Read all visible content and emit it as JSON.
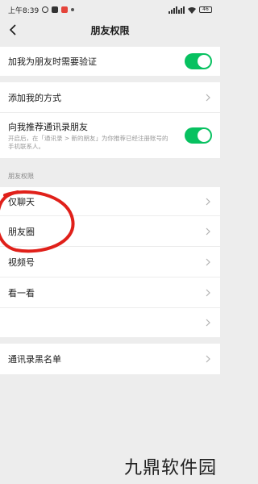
{
  "status_bar": {
    "time": "上午8:39",
    "battery": "46"
  },
  "nav": {
    "title": "朋友权限",
    "back_icon": "chevron-left-icon"
  },
  "settings": {
    "verify_label": "加我为朋友时需要验证",
    "verify_on": true,
    "add_methods_label": "添加我的方式",
    "recommend_label": "向我推荐通讯录朋友",
    "recommend_desc": "开启后，在「通讯录 > 新的朋友」为你推荐已经注册账号的手机联系人。",
    "recommend_on": true
  },
  "friend_permissions": {
    "header": "朋友权限",
    "items": [
      {
        "label": "仅聊天"
      },
      {
        "label": "朋友圈"
      },
      {
        "label": "视频号"
      },
      {
        "label": "看一看"
      },
      {
        "label": ""
      }
    ]
  },
  "blacklist": {
    "label": "通讯录黑名单"
  },
  "watermark": "九鼎软件园",
  "colors": {
    "toggle_on": "#07c160",
    "annotation": "#e0201a",
    "background": "#ededed"
  }
}
